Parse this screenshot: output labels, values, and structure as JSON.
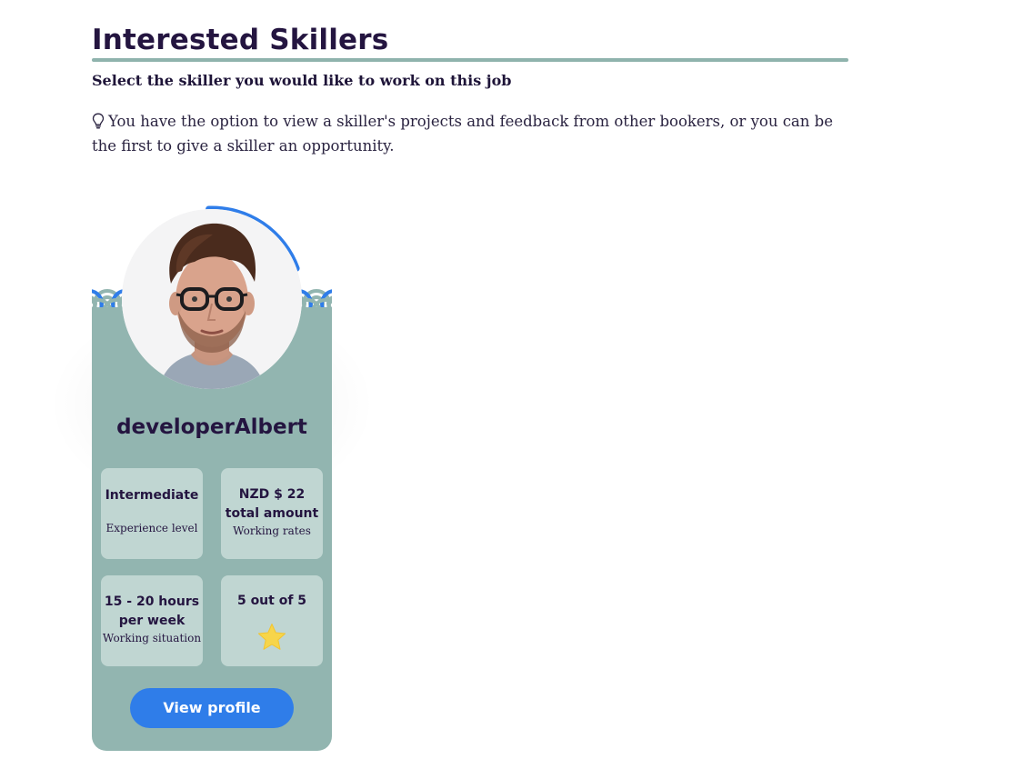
{
  "header": {
    "title": "Interested Skillers",
    "subtitle": "Select the skiller you would like to work on this job",
    "tip_text": "You have the option to view a skiller's projects and feedback from other bookers, or you can be the first to give a skiller an opportunity.",
    "tip_icon": "lightbulb-icon"
  },
  "skillers": [
    {
      "username": "developerAlbert",
      "experience": {
        "value": "Intermediate",
        "caption": "Experience level"
      },
      "rate": {
        "line1": "NZD $ 22",
        "line2": "total amount",
        "caption": "Working rates"
      },
      "hours": {
        "line1": "15 - 20 hours",
        "line2": "per week",
        "caption": "Working situation"
      },
      "rating": {
        "value": "5 out of 5",
        "icon": "star-icon"
      },
      "profile_completion_fraction": 0.2,
      "view_profile_label": "View profile"
    }
  ],
  "colors": {
    "card_background": "#92b5b0",
    "stat_box_background": "#c0d6d2",
    "accent_blue": "#2f7de9",
    "title_text": "#241540",
    "underline": "#8fb3ad",
    "star": "#f7d54a"
  }
}
